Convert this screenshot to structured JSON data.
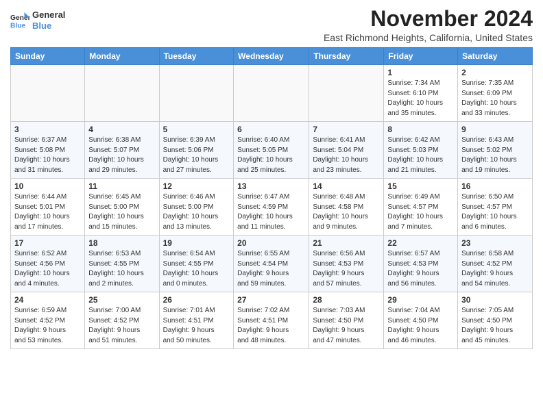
{
  "header": {
    "logo_line1": "General",
    "logo_line2": "Blue",
    "month_title": "November 2024",
    "subtitle": "East Richmond Heights, California, United States"
  },
  "weekdays": [
    "Sunday",
    "Monday",
    "Tuesday",
    "Wednesday",
    "Thursday",
    "Friday",
    "Saturday"
  ],
  "weeks": [
    [
      {
        "day": "",
        "info": ""
      },
      {
        "day": "",
        "info": ""
      },
      {
        "day": "",
        "info": ""
      },
      {
        "day": "",
        "info": ""
      },
      {
        "day": "",
        "info": ""
      },
      {
        "day": "1",
        "info": "Sunrise: 7:34 AM\nSunset: 6:10 PM\nDaylight: 10 hours\nand 35 minutes."
      },
      {
        "day": "2",
        "info": "Sunrise: 7:35 AM\nSunset: 6:09 PM\nDaylight: 10 hours\nand 33 minutes."
      }
    ],
    [
      {
        "day": "3",
        "info": "Sunrise: 6:37 AM\nSunset: 5:08 PM\nDaylight: 10 hours\nand 31 minutes."
      },
      {
        "day": "4",
        "info": "Sunrise: 6:38 AM\nSunset: 5:07 PM\nDaylight: 10 hours\nand 29 minutes."
      },
      {
        "day": "5",
        "info": "Sunrise: 6:39 AM\nSunset: 5:06 PM\nDaylight: 10 hours\nand 27 minutes."
      },
      {
        "day": "6",
        "info": "Sunrise: 6:40 AM\nSunset: 5:05 PM\nDaylight: 10 hours\nand 25 minutes."
      },
      {
        "day": "7",
        "info": "Sunrise: 6:41 AM\nSunset: 5:04 PM\nDaylight: 10 hours\nand 23 minutes."
      },
      {
        "day": "8",
        "info": "Sunrise: 6:42 AM\nSunset: 5:03 PM\nDaylight: 10 hours\nand 21 minutes."
      },
      {
        "day": "9",
        "info": "Sunrise: 6:43 AM\nSunset: 5:02 PM\nDaylight: 10 hours\nand 19 minutes."
      }
    ],
    [
      {
        "day": "10",
        "info": "Sunrise: 6:44 AM\nSunset: 5:01 PM\nDaylight: 10 hours\nand 17 minutes."
      },
      {
        "day": "11",
        "info": "Sunrise: 6:45 AM\nSunset: 5:00 PM\nDaylight: 10 hours\nand 15 minutes."
      },
      {
        "day": "12",
        "info": "Sunrise: 6:46 AM\nSunset: 5:00 PM\nDaylight: 10 hours\nand 13 minutes."
      },
      {
        "day": "13",
        "info": "Sunrise: 6:47 AM\nSunset: 4:59 PM\nDaylight: 10 hours\nand 11 minutes."
      },
      {
        "day": "14",
        "info": "Sunrise: 6:48 AM\nSunset: 4:58 PM\nDaylight: 10 hours\nand 9 minutes."
      },
      {
        "day": "15",
        "info": "Sunrise: 6:49 AM\nSunset: 4:57 PM\nDaylight: 10 hours\nand 7 minutes."
      },
      {
        "day": "16",
        "info": "Sunrise: 6:50 AM\nSunset: 4:57 PM\nDaylight: 10 hours\nand 6 minutes."
      }
    ],
    [
      {
        "day": "17",
        "info": "Sunrise: 6:52 AM\nSunset: 4:56 PM\nDaylight: 10 hours\nand 4 minutes."
      },
      {
        "day": "18",
        "info": "Sunrise: 6:53 AM\nSunset: 4:55 PM\nDaylight: 10 hours\nand 2 minutes."
      },
      {
        "day": "19",
        "info": "Sunrise: 6:54 AM\nSunset: 4:55 PM\nDaylight: 10 hours\nand 0 minutes."
      },
      {
        "day": "20",
        "info": "Sunrise: 6:55 AM\nSunset: 4:54 PM\nDaylight: 9 hours\nand 59 minutes."
      },
      {
        "day": "21",
        "info": "Sunrise: 6:56 AM\nSunset: 4:53 PM\nDaylight: 9 hours\nand 57 minutes."
      },
      {
        "day": "22",
        "info": "Sunrise: 6:57 AM\nSunset: 4:53 PM\nDaylight: 9 hours\nand 56 minutes."
      },
      {
        "day": "23",
        "info": "Sunrise: 6:58 AM\nSunset: 4:52 PM\nDaylight: 9 hours\nand 54 minutes."
      }
    ],
    [
      {
        "day": "24",
        "info": "Sunrise: 6:59 AM\nSunset: 4:52 PM\nDaylight: 9 hours\nand 53 minutes."
      },
      {
        "day": "25",
        "info": "Sunrise: 7:00 AM\nSunset: 4:52 PM\nDaylight: 9 hours\nand 51 minutes."
      },
      {
        "day": "26",
        "info": "Sunrise: 7:01 AM\nSunset: 4:51 PM\nDaylight: 9 hours\nand 50 minutes."
      },
      {
        "day": "27",
        "info": "Sunrise: 7:02 AM\nSunset: 4:51 PM\nDaylight: 9 hours\nand 48 minutes."
      },
      {
        "day": "28",
        "info": "Sunrise: 7:03 AM\nSunset: 4:50 PM\nDaylight: 9 hours\nand 47 minutes."
      },
      {
        "day": "29",
        "info": "Sunrise: 7:04 AM\nSunset: 4:50 PM\nDaylight: 9 hours\nand 46 minutes."
      },
      {
        "day": "30",
        "info": "Sunrise: 7:05 AM\nSunset: 4:50 PM\nDaylight: 9 hours\nand 45 minutes."
      }
    ]
  ]
}
